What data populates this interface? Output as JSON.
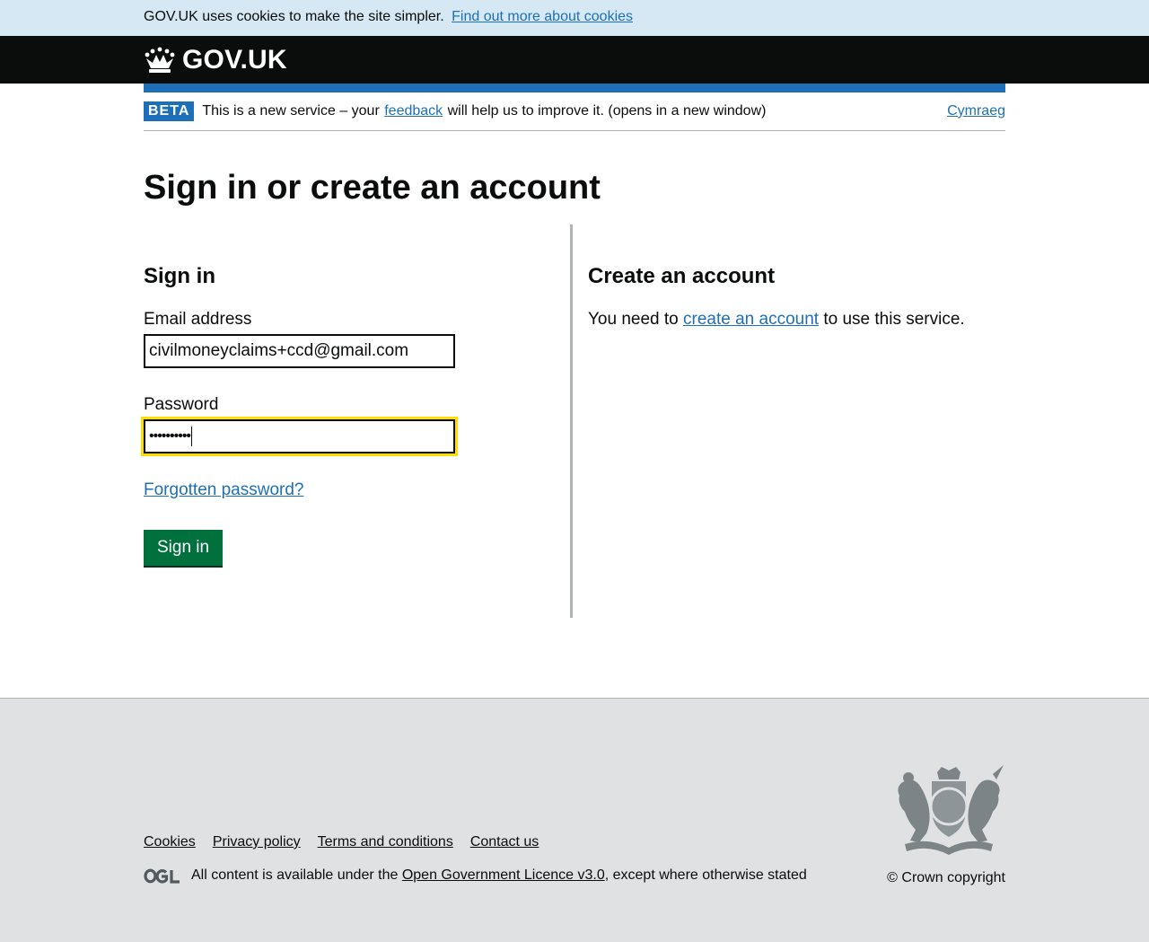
{
  "cookie_banner": {
    "text": "GOV.UK uses cookies to make the site simpler.",
    "link": "Find out more about cookies"
  },
  "header": {
    "logo_text": "GOV.UK",
    "logo_icon": "crown-icon"
  },
  "phase_banner": {
    "tag": "BETA",
    "text_before": "This is a new service – your",
    "feedback_link": "feedback",
    "text_after": "will help us to improve it. (opens in a new window)",
    "language_link": "Cymraeg"
  },
  "page_title": "Sign in or create an account",
  "sign_in": {
    "heading": "Sign in",
    "email_label": "Email address",
    "email_value": "civilmoneyclaims+ccd@gmail.com",
    "password_label": "Password",
    "password_value": "••••••••••",
    "forgot_link": "Forgotten password?",
    "submit_label": "Sign in"
  },
  "create_account": {
    "heading": "Create an account",
    "text_before": "You need to",
    "link": "create an account",
    "text_after": "to use this service."
  },
  "footer": {
    "links": [
      "Cookies",
      "Privacy policy",
      "Terms and conditions",
      "Contact us"
    ],
    "licence_before": "All content is available under the",
    "licence_link": "Open Government Licence v3.0",
    "licence_after": ", except where otherwise stated",
    "copyright": "© Crown copyright",
    "ogl_icon": "ogl-logo-icon",
    "crest_icon": "royal-coat-of-arms-icon"
  },
  "colors": {
    "link": "#1d70b8",
    "header_bg": "#0b0c0c",
    "button": "#00703c",
    "focus": "#fbc26a",
    "footer_bg": "#dfe1e3",
    "cookie_bg": "#d5e8f3"
  }
}
